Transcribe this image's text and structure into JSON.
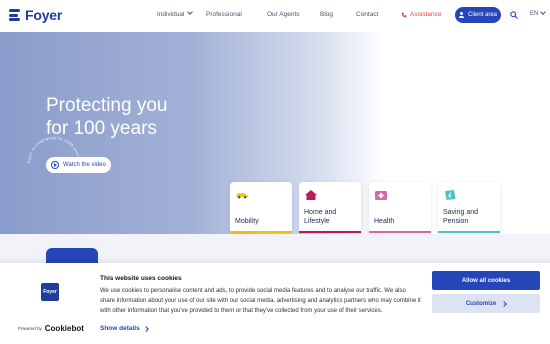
{
  "brand": {
    "name": "Foyer",
    "primary": "#2546b8",
    "accent_red": "#e8474f"
  },
  "nav": {
    "items": [
      {
        "label": "Individual",
        "has_dropdown": true
      },
      {
        "label": "Professional"
      },
      {
        "label": "Our Agents"
      },
      {
        "label": "Blog"
      },
      {
        "label": "Contact"
      }
    ],
    "assistance": "Assistance",
    "client_area": "Client area",
    "language": "EN",
    "icons": {
      "assistance": "phone-icon",
      "client": "user-icon",
      "search": "search-icon"
    }
  },
  "hero": {
    "title_line1": "Protecting you",
    "title_line2": "for 100 years",
    "watch_label": "Watch the video",
    "circle_text": "Foyer is celebrating its 100th anniversary"
  },
  "categories": [
    {
      "label_line1": "Mobility",
      "label_line2": "",
      "icon": "car-icon",
      "color": "#e8c01e"
    },
    {
      "label_line1": "Home and",
      "label_line2": "Lifestyle",
      "icon": "house-icon",
      "color": "#c2185b"
    },
    {
      "label_line1": "Health",
      "label_line2": "",
      "icon": "health-icon",
      "color": "#d06ba8"
    },
    {
      "label_line1": "Saving and",
      "label_line2": "Pension",
      "icon": "piggy-icon",
      "color": "#4fc3c7"
    }
  ],
  "cookie": {
    "title": "This website uses cookies",
    "text": "We use cookies to personalise content and ads, to provide social media features and to analyse our traffic. We also share information about your use of our site with our social media, advertising and analytics partners who may combine it with other information that you've provided to them or that they've collected from your use of their services.",
    "details": "Show details",
    "allow": "Allow all cookies",
    "customize": "Customize",
    "powered_by": "Powered by",
    "cookiebot": "Cookiebot",
    "logo_text": "Foyer"
  }
}
